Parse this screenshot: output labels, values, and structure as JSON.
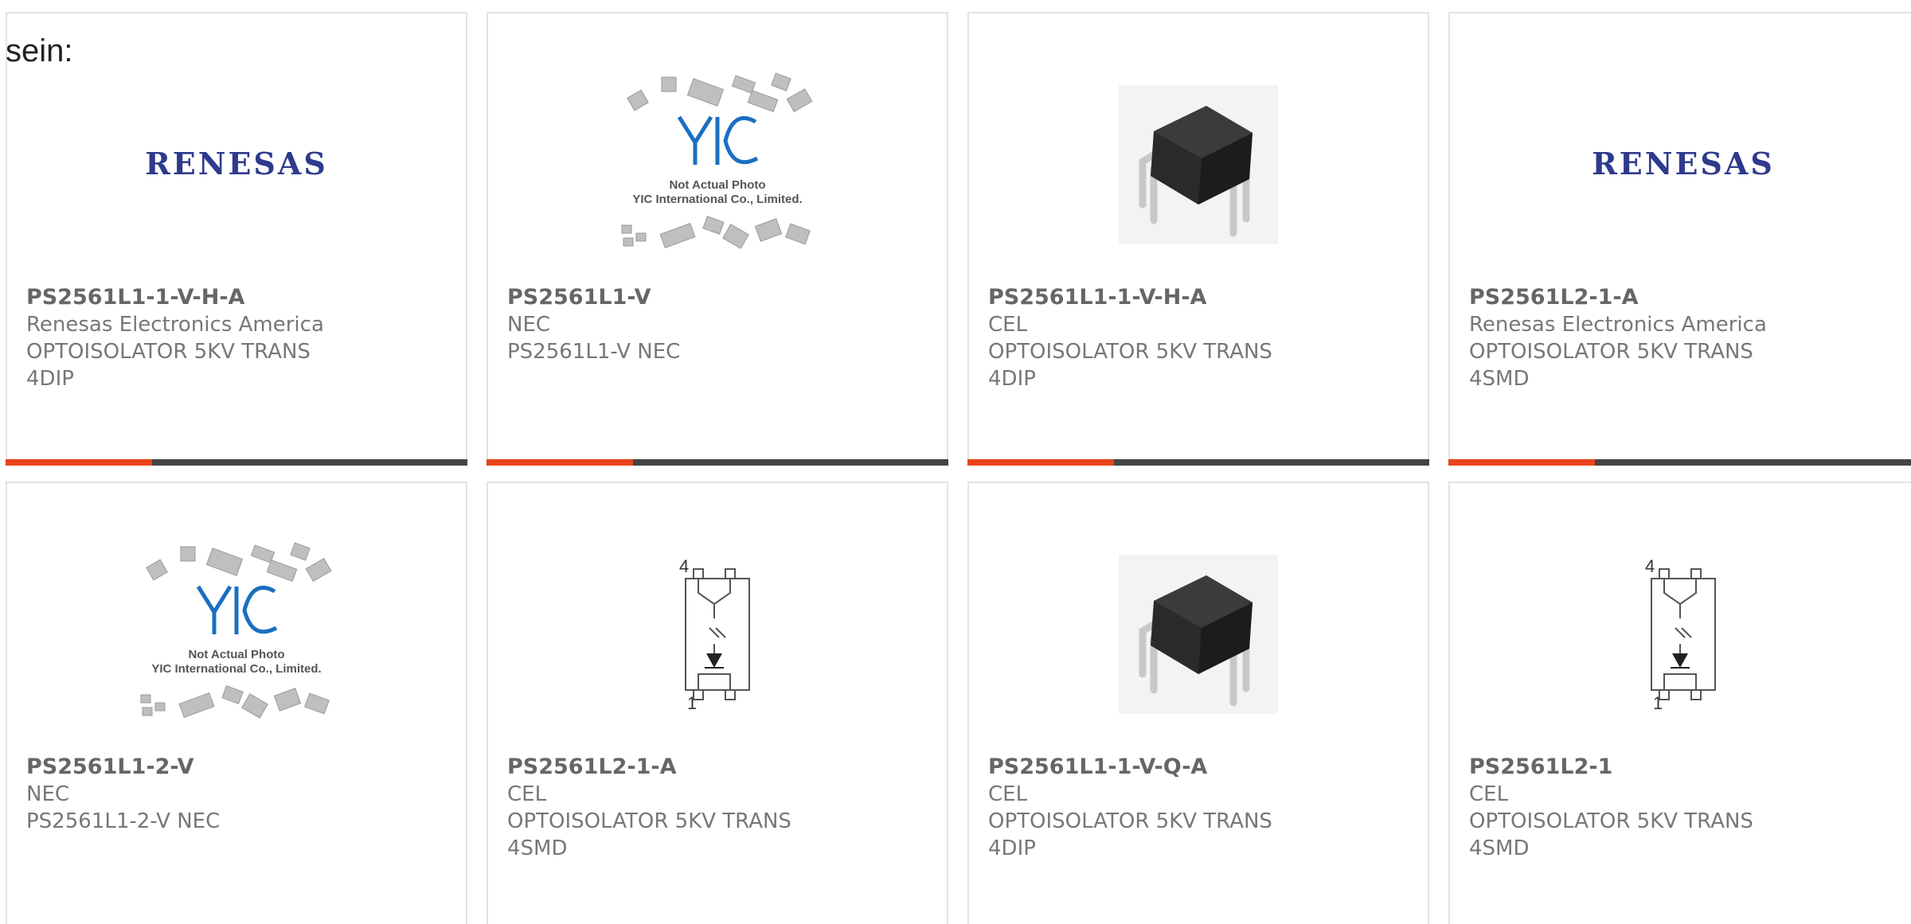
{
  "intro_text": "sein:",
  "colors": {
    "accent": "#e8431c",
    "bar": "#444444",
    "renesas_blue": "#2e3a8c",
    "yic_blue": "#1a6fc1"
  },
  "products": [
    {
      "part_number": "PS2561L1-1-V-H-A",
      "manufacturer": "Renesas Electronics America",
      "description": "OPTOISOLATOR 5KV TRANS 4DIP",
      "image": "renesas-logo",
      "logo_text": "RENESAS"
    },
    {
      "part_number": "PS2561L1-V",
      "manufacturer": "NEC",
      "description": "PS2561L1-V NEC",
      "image": "yic-placeholder",
      "placeholder_line1": "Not Actual Photo",
      "placeholder_line2": "YIC International Co., Limited."
    },
    {
      "part_number": "PS2561L1-1-V-H-A",
      "manufacturer": "CEL",
      "description": "OPTOISOLATOR 5KV TRANS 4DIP",
      "image": "dip-package-photo"
    },
    {
      "part_number": "PS2561L2-1-A",
      "manufacturer": "Renesas Electronics America",
      "description": "OPTOISOLATOR 5KV TRANS 4SMD",
      "image": "renesas-logo",
      "logo_text": "RENESAS"
    },
    {
      "part_number": "PS2561L1-2-V",
      "manufacturer": "NEC",
      "description": "PS2561L1-2-V NEC",
      "image": "yic-placeholder",
      "placeholder_line1": "Not Actual Photo",
      "placeholder_line2": "YIC International Co., Limited."
    },
    {
      "part_number": "PS2561L2-1-A",
      "manufacturer": "CEL",
      "description": "OPTOISOLATOR 5KV TRANS 4SMD",
      "image": "optocoupler-schematic",
      "pin_top": "4",
      "pin_bottom": "1"
    },
    {
      "part_number": "PS2561L1-1-V-Q-A",
      "manufacturer": "CEL",
      "description": "OPTOISOLATOR 5KV TRANS 4DIP",
      "image": "dip-package-photo"
    },
    {
      "part_number": "PS2561L2-1",
      "manufacturer": "CEL",
      "description": "OPTOISOLATOR 5KV TRANS 4SMD",
      "image": "optocoupler-schematic",
      "pin_top": "4",
      "pin_bottom": "1"
    }
  ]
}
